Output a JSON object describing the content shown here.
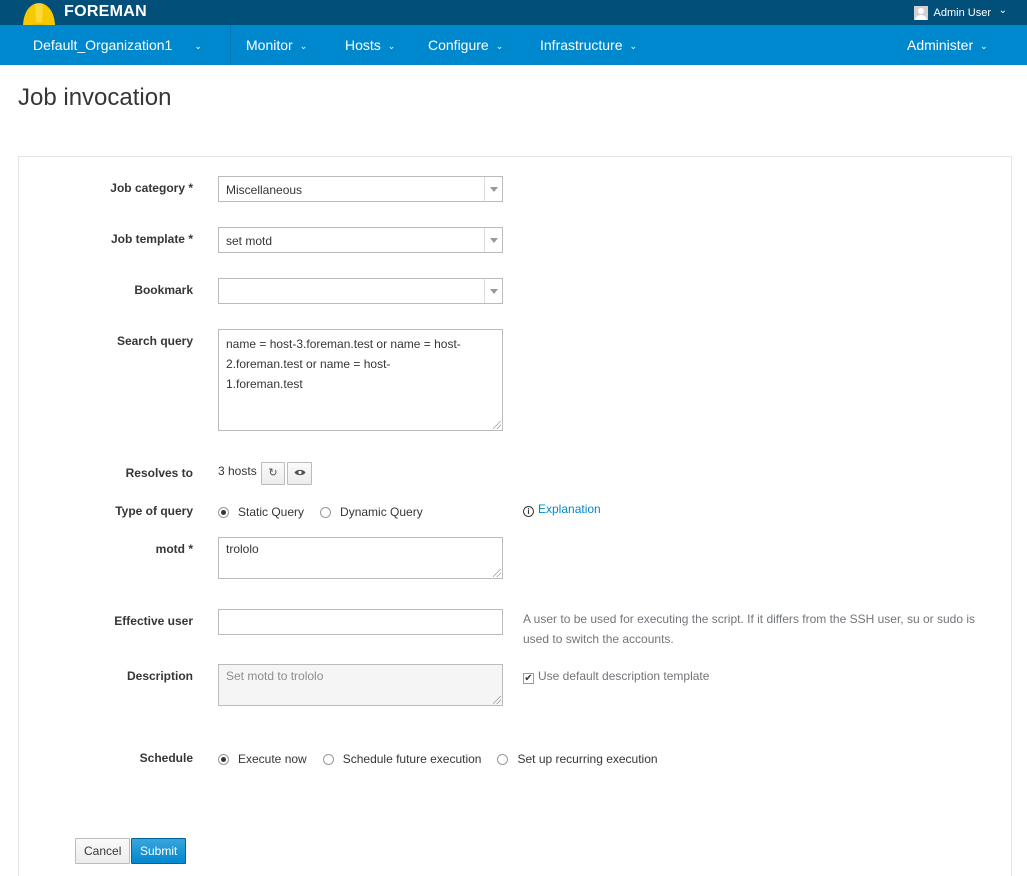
{
  "app": {
    "brand": "FOREMAN",
    "user_name": "Admin User",
    "colors": {
      "topbar": "#025079",
      "navbar": "#0088ce",
      "link": "#0088ce",
      "primary": "#0088ce"
    }
  },
  "nav": {
    "org": "Default_Organization1",
    "items": [
      "Monitor",
      "Hosts",
      "Configure",
      "Infrastructure"
    ],
    "admin": "Administer"
  },
  "page": {
    "title": "Job invocation"
  },
  "form": {
    "job_category": {
      "label": "Job category *",
      "value": "Miscellaneous"
    },
    "job_template": {
      "label": "Job template *",
      "value": "set motd"
    },
    "bookmark": {
      "label": "Bookmark",
      "value": ""
    },
    "search_query": {
      "label": "Search query",
      "lines": [
        "name = host-3.foreman.test or name = host-",
        "2.foreman.test or name = host-",
        "1.foreman.test"
      ]
    },
    "resolves_to": {
      "label": "Resolves to",
      "value": "3 hosts",
      "refresh_icon": "refresh-icon",
      "preview_icon": "eye-icon"
    },
    "type_of_query": {
      "label": "Type of query",
      "options": [
        "Static Query",
        "Dynamic Query"
      ],
      "selected": "Static Query",
      "explanation": "Explanation"
    },
    "motd": {
      "label": "motd *",
      "value": "trololo"
    },
    "effective_user": {
      "label": "Effective user",
      "value": "",
      "help": "A user to be used for executing the script. If it differs from the SSH user, su or sudo is used to switch the accounts."
    },
    "description": {
      "label": "Description",
      "value": "Set motd to trololo",
      "use_default_label": "Use default description template",
      "use_default_checked": true
    },
    "schedule": {
      "label": "Schedule",
      "options": [
        "Execute now",
        "Schedule future execution",
        "Set up recurring execution"
      ],
      "selected": "Execute now"
    }
  },
  "actions": {
    "cancel": "Cancel",
    "submit": "Submit"
  }
}
